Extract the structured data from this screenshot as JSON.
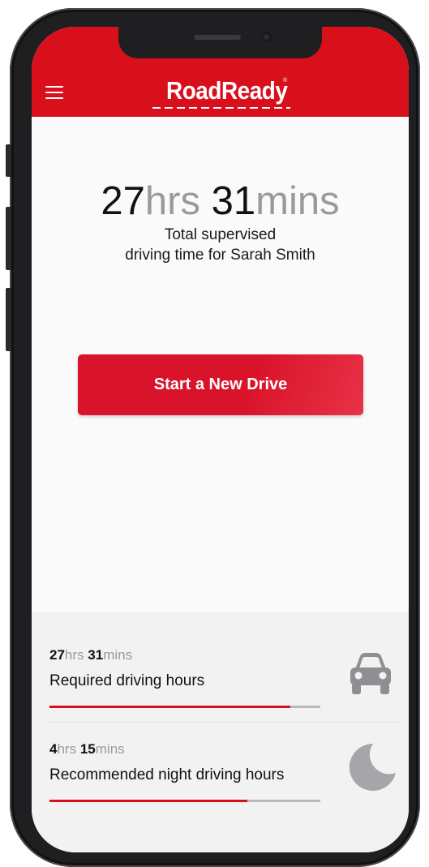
{
  "app": {
    "logo": "RoadReady",
    "trademark": "®"
  },
  "total": {
    "hours": "27",
    "hours_unit": "hrs",
    "minutes": "31",
    "minutes_unit": "mins",
    "caption_line1": "Total supervised",
    "caption_line2": "driving time for Sarah Smith"
  },
  "actions": {
    "start_label": "Start a New Drive"
  },
  "stats": [
    {
      "hours": "27",
      "hours_unit": "hrs",
      "minutes": "31",
      "minutes_unit": "mins",
      "label": "Required driving hours",
      "progress": 0.89,
      "icon": "car-icon"
    },
    {
      "hours": "4",
      "hours_unit": "hrs",
      "minutes": "15",
      "minutes_unit": "mins",
      "label": "Recommended night driving hours",
      "progress": 0.73,
      "icon": "moon-icon"
    }
  ],
  "colors": {
    "brand_red": "#d9101c",
    "muted_gray": "#9a9a9e",
    "track_gray": "#b9b9bd"
  }
}
